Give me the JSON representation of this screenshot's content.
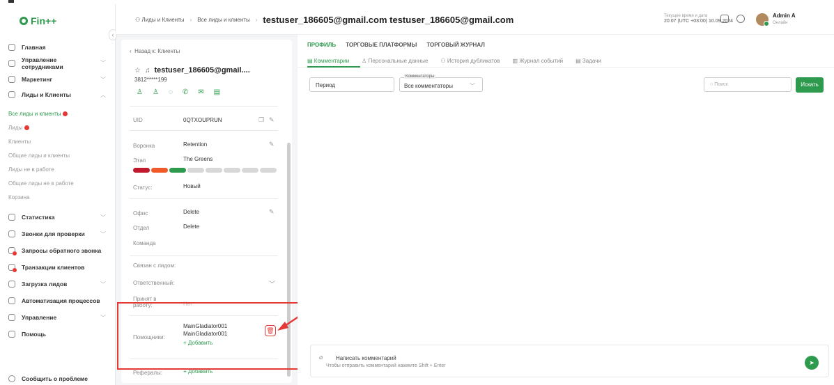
{
  "app": {
    "logo": "Fin++"
  },
  "sidebar": {
    "items": [
      {
        "label": "Главная"
      },
      {
        "label": "Управление сотрудниками"
      },
      {
        "label": "Маркетинг"
      },
      {
        "label": "Лиды и Клиенты"
      }
    ],
    "sub": [
      "Все лиды и клиенты",
      "Лиды",
      "Клиенты",
      "Общие лиды и клиенты",
      "Лиды не в работе",
      "Общие лиды не в работе",
      "Корзина"
    ],
    "items2": [
      "Статистика",
      "Звонки для проверки",
      "Запросы обратного звонка",
      "Транзакции клиентов",
      "Загрузка лидов",
      "Автоматизация процессов",
      "Управление",
      "Помощь"
    ],
    "report": "Сообщить о проблеме"
  },
  "header": {
    "bc1": "Лиды и Клиенты",
    "bc2": "Все лиды и клиенты",
    "title": "testuser_186605@gmail.com testuser_186605@gmail.com",
    "dt_label": "Текущее время и дата",
    "dt_value": "20:07 (UTC +03:00) 10.09.2024",
    "user": "Admin A",
    "status": "Онлайн"
  },
  "card": {
    "back": "Назад к: Клиенты",
    "name": "testuser_186605@gmail....",
    "phone": "3812*****199",
    "uid_label": "UID",
    "uid": "0QTXOUPRUN",
    "funnel_label": "Воронка",
    "funnel": "Retention",
    "stage_label": "Этап",
    "stage": "The Greens",
    "status_label": "Статус:",
    "status": "Новый",
    "office_label": "Офис",
    "office": "Delete",
    "dept_label": "Отдел",
    "dept": "Delete",
    "team_label": "Команда",
    "linked_label": "Связан с лидом:",
    "resp_label": "Ответственный:",
    "accepted_label": "Принят в работу:",
    "accepted": "Нет",
    "helpers_label": "Помощники:",
    "helper1": "MainGladiator001",
    "helper2": "MainGladiator001",
    "add": "+ Добавить",
    "ref_label": "Рефералы:",
    "ref_add": "+ Добавить"
  },
  "main": {
    "tabs": [
      "ПРОФИЛЬ",
      "ТОРГОВЫЕ ПЛАТФОРМЫ",
      "ТОРГОВЫЙ ЖУРНАЛ"
    ],
    "subtabs": [
      "Комментарии",
      "Персональные данные",
      "История дубликатов",
      "Журнал событий",
      "Задачи"
    ],
    "period": "Период",
    "commentators_label": "Комментаторы",
    "commentators": "Все комментаторы",
    "search_ph": "Поиск",
    "search_btn": "Искать",
    "compose_title": "Написать комментарий",
    "compose_hint": "Чтобы отправить комментарий нажмите Shift + Enter"
  },
  "colors": {
    "accent": "#2e9a4d",
    "stages": [
      "#c0192b",
      "#f05a28",
      "#2e9a4d"
    ]
  }
}
